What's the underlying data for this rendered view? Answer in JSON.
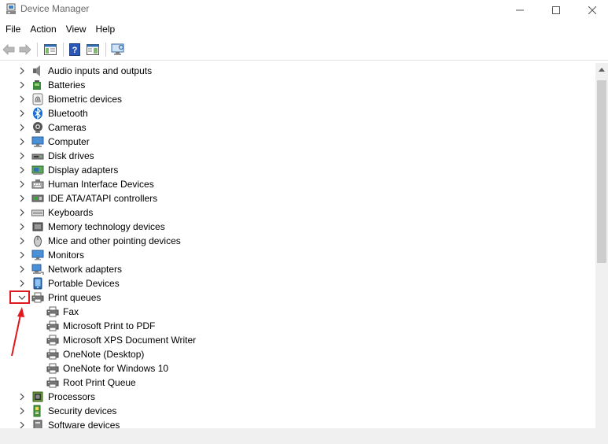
{
  "window": {
    "title": "Device Manager",
    "controls": [
      "minimize",
      "maximize",
      "close"
    ]
  },
  "menu": [
    "File",
    "Action",
    "View",
    "Help"
  ],
  "toolbar": {
    "buttons": [
      "back-arrow-icon",
      "forward-arrow-icon",
      "show-hide-console-tree-icon",
      "help-icon",
      "properties-icon",
      "scan-hardware-icon"
    ]
  },
  "tree": {
    "categories": [
      {
        "label": "Audio inputs and outputs",
        "icon": "speaker-icon",
        "expanded": false
      },
      {
        "label": "Batteries",
        "icon": "battery-icon",
        "expanded": false
      },
      {
        "label": "Biometric devices",
        "icon": "fingerprint-icon",
        "expanded": false
      },
      {
        "label": "Bluetooth",
        "icon": "bluetooth-icon",
        "expanded": false
      },
      {
        "label": "Cameras",
        "icon": "camera-icon",
        "expanded": false
      },
      {
        "label": "Computer",
        "icon": "computer-icon",
        "expanded": false
      },
      {
        "label": "Disk drives",
        "icon": "disk-drive-icon",
        "expanded": false
      },
      {
        "label": "Display adapters",
        "icon": "display-adapter-icon",
        "expanded": false
      },
      {
        "label": "Human Interface Devices",
        "icon": "hid-icon",
        "expanded": false
      },
      {
        "label": "IDE ATA/ATAPI controllers",
        "icon": "ide-controller-icon",
        "expanded": false
      },
      {
        "label": "Keyboards",
        "icon": "keyboard-icon",
        "expanded": false
      },
      {
        "label": "Memory technology devices",
        "icon": "memory-icon",
        "expanded": false
      },
      {
        "label": "Mice and other pointing devices",
        "icon": "mouse-icon",
        "expanded": false
      },
      {
        "label": "Monitors",
        "icon": "monitor-icon",
        "expanded": false
      },
      {
        "label": "Network adapters",
        "icon": "network-icon",
        "expanded": false
      },
      {
        "label": "Portable Devices",
        "icon": "portable-device-icon",
        "expanded": false
      },
      {
        "label": "Print queues",
        "icon": "printer-icon",
        "expanded": true,
        "children": [
          "Fax",
          "Microsoft Print to PDF",
          "Microsoft XPS Document Writer",
          "OneNote (Desktop)",
          "OneNote for Windows 10",
          "Root Print Queue"
        ]
      },
      {
        "label": "Processors",
        "icon": "processor-icon",
        "expanded": false
      },
      {
        "label": "Security devices",
        "icon": "security-device-icon",
        "expanded": false
      },
      {
        "label": "Software devices",
        "icon": "software-device-icon",
        "expanded": false
      }
    ]
  },
  "annotation": {
    "highlight_color": "#e0191e",
    "target": "print-queues-expand-chevron"
  }
}
